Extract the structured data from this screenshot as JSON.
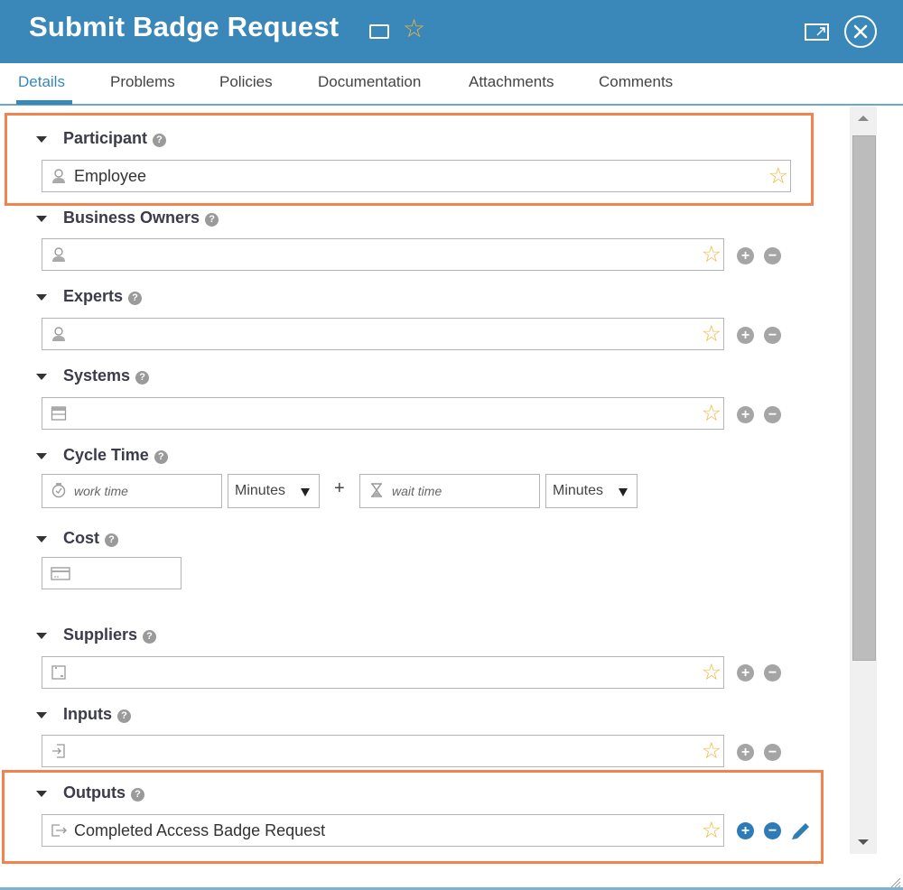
{
  "header": {
    "title": "Submit Badge Request",
    "icons": [
      "rectangle-icon",
      "favorite-star-icon",
      "popout-icon",
      "close-icon"
    ]
  },
  "tabs": [
    {
      "label": "Details",
      "active": true
    },
    {
      "label": "Problems",
      "active": false
    },
    {
      "label": "Policies",
      "active": false
    },
    {
      "label": "Documentation",
      "active": false
    },
    {
      "label": "Attachments",
      "active": false
    },
    {
      "label": "Comments",
      "active": false
    }
  ],
  "sections": {
    "participant": {
      "title": "Participant",
      "value": "Employee",
      "icon": "person-icon"
    },
    "business_owners": {
      "title": "Business Owners",
      "value": "",
      "icon": "person-icon"
    },
    "experts": {
      "title": "Experts",
      "value": "",
      "icon": "person-icon"
    },
    "systems": {
      "title": "Systems",
      "value": "",
      "icon": "server-icon"
    },
    "cycle_time": {
      "title": "Cycle Time",
      "work_time_placeholder": "work time",
      "work_unit": "Minutes",
      "plus": "+",
      "wait_time_placeholder": "wait time",
      "wait_unit": "Minutes"
    },
    "cost": {
      "title": "Cost",
      "value": "",
      "icon": "credit-card-icon"
    },
    "suppliers": {
      "title": "Suppliers",
      "value": "",
      "icon": "supplier-box-icon"
    },
    "inputs": {
      "title": "Inputs",
      "value": "",
      "icon": "input-arrow-icon"
    },
    "outputs": {
      "title": "Outputs",
      "value": "Completed Access Badge Request",
      "icon": "output-arrow-icon"
    }
  },
  "glyphs": {
    "help": "?",
    "star": "☆",
    "add": "+",
    "remove": "−"
  },
  "colors": {
    "header_bg": "#3a87b9",
    "highlight_border": "#f2834f",
    "star": "#f3b73a",
    "action_blue": "#2f7bb5",
    "action_gray": "#a5a5a5"
  }
}
